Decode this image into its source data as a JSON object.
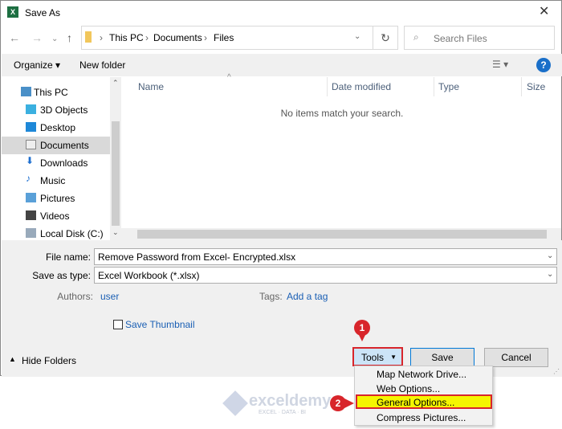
{
  "window": {
    "title": "Save As",
    "close": "✕"
  },
  "address": {
    "crumbs": [
      "This PC",
      "Documents",
      "Files"
    ],
    "search_placeholder": "Search Files"
  },
  "toolbar": {
    "organize": "Organize ▾",
    "new_folder": "New folder",
    "help": "?"
  },
  "sidebar": {
    "items": [
      "This PC",
      "3D Objects",
      "Desktop",
      "Documents",
      "Downloads",
      "Music",
      "Pictures",
      "Videos",
      "Local Disk (C:)"
    ]
  },
  "columns": [
    "Name",
    "Date modified",
    "Type",
    "Size"
  ],
  "empty_message": "No items match your search.",
  "form": {
    "file_name_label": "File name:",
    "file_name": "Remove Password from Excel- Encrypted.xlsx",
    "type_label": "Save as type:",
    "type": "Excel Workbook (*.xlsx)",
    "authors_label": "Authors:",
    "authors": "user",
    "tags_label": "Tags:",
    "tags": "Add a tag",
    "thumbnail": "Save Thumbnail"
  },
  "buttons": {
    "hide_folders": "Hide Folders",
    "tools": "Tools",
    "save": "Save",
    "cancel": "Cancel"
  },
  "tools_menu": [
    "Map Network Drive...",
    "Web Options...",
    "General Options...",
    "Compress Pictures..."
  ],
  "badges": [
    "1",
    "2"
  ],
  "watermark": {
    "brand": "exceldemy",
    "tagline": "EXCEL · DATA · BI"
  },
  "colors": {
    "highlight": "#f5f500",
    "annotation": "#d8252b"
  }
}
